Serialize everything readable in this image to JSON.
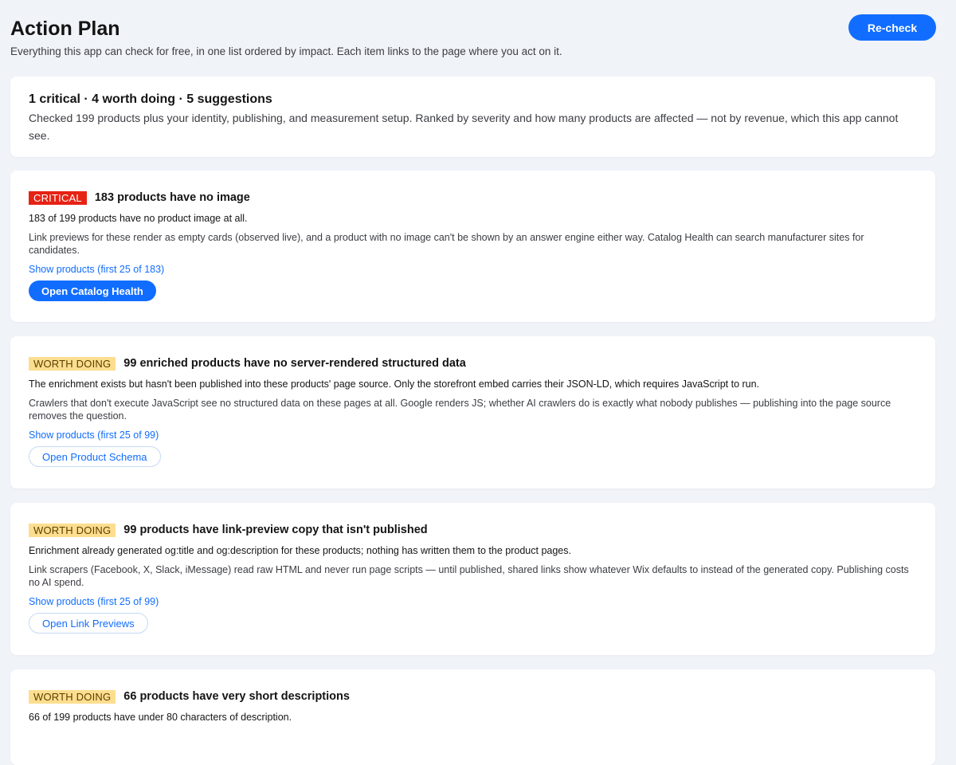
{
  "header": {
    "title": "Action Plan",
    "subtitle": "Everything this app can check for free, in one list ordered by impact. Each item links to the page where you act on it.",
    "recheck_label": "Re-check"
  },
  "summary": {
    "title": "1 critical · 4 worth doing · 5 suggestions",
    "text": "Checked 199 products plus your identity, publishing, and measurement setup. Ranked by severity and how many products are affected — not by revenue, which this app cannot see."
  },
  "items": [
    {
      "severity": "CRITICAL",
      "title": "183 products have no image",
      "detail": "183 of 199 products have no product image at all.",
      "why": "Link previews for these render as empty cards (observed live), and a product with no image can't be shown by an answer engine either way. Catalog Health can search manufacturer sites for candidates.",
      "link": "Show products (first 25 of 183)",
      "action": "Open Catalog Health"
    },
    {
      "severity": "WORTH DOING",
      "title": "99 enriched products have no server-rendered structured data",
      "detail": "The enrichment exists but hasn't been published into these products' page source. Only the storefront embed carries their JSON-LD, which requires JavaScript to run.",
      "why": "Crawlers that don't execute JavaScript see no structured data on these pages at all. Google renders JS; whether AI crawlers do is exactly what nobody publishes — publishing into the page source removes the question.",
      "link": "Show products (first 25 of 99)",
      "action": "Open Product Schema"
    },
    {
      "severity": "WORTH DOING",
      "title": "99 products have link-preview copy that isn't published",
      "detail": "Enrichment already generated og:title and og:description for these products; nothing has written them to the product pages.",
      "why": "Link scrapers (Facebook, X, Slack, iMessage) read raw HTML and never run page scripts — until published, shared links show whatever Wix defaults to instead of the generated copy. Publishing costs no AI spend.",
      "link": "Show products (first 25 of 99)",
      "action": "Open Link Previews"
    },
    {
      "severity": "WORTH DOING",
      "title": "66 products have very short descriptions",
      "detail": "66 of 199 products have under 80 characters of description."
    }
  ],
  "colors": {
    "accent": "#116dff",
    "critical": "#e62214",
    "worth_doing": "#fdde8f",
    "background": "#f0f3f8"
  }
}
